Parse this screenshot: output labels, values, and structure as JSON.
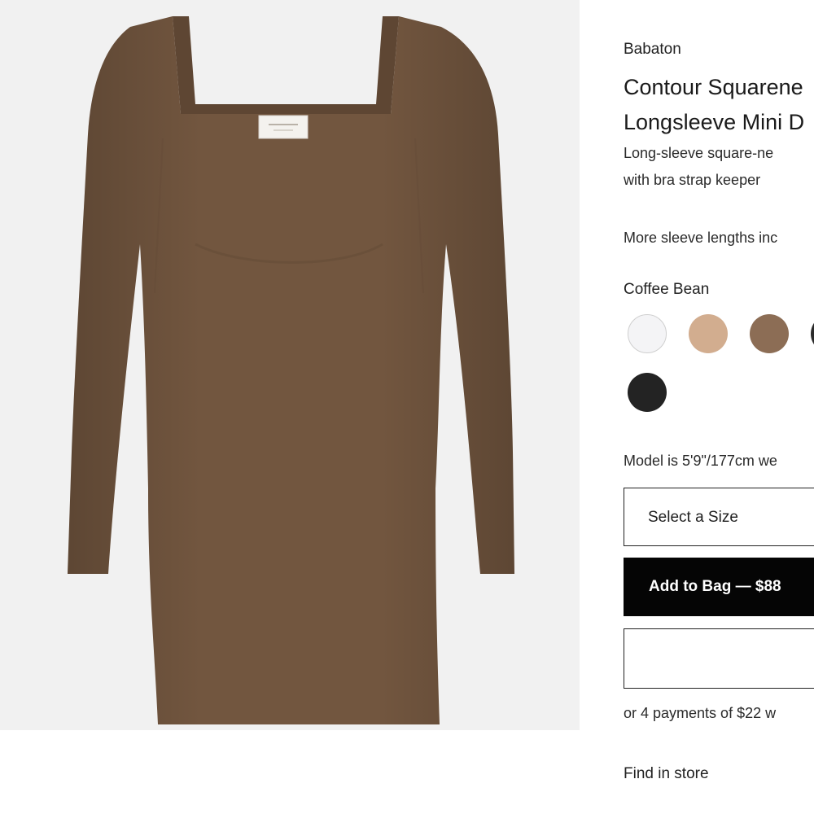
{
  "product": {
    "brand": "Babaton",
    "title_line1": "Contour Squarene",
    "title_line2": "Longsleeve Mini D",
    "desc_line1": "Long-sleeve square-ne",
    "desc_line2": "with bra strap keeper",
    "sleeve_note": "More sleeve lengths inc",
    "color_name": "Coffee Bean",
    "model_info": "Model is 5'9\"/177cm we",
    "size_select_label": "Select a Size",
    "add_to_bag_label": "Add to Bag — $88",
    "payments_note": "or 4 payments of $22 w",
    "find_in_store": "Find in store"
  },
  "swatches": [
    {
      "name": "white",
      "color": "#f4f4f6"
    },
    {
      "name": "nude",
      "color": "#d2ad8f"
    },
    {
      "name": "coffee-bean",
      "color": "#8c6d55"
    },
    {
      "name": "black",
      "color": "#232323"
    }
  ],
  "colors": {
    "dress": "#72563f",
    "background": "#f1f1f1",
    "button_bg": "#050505"
  }
}
